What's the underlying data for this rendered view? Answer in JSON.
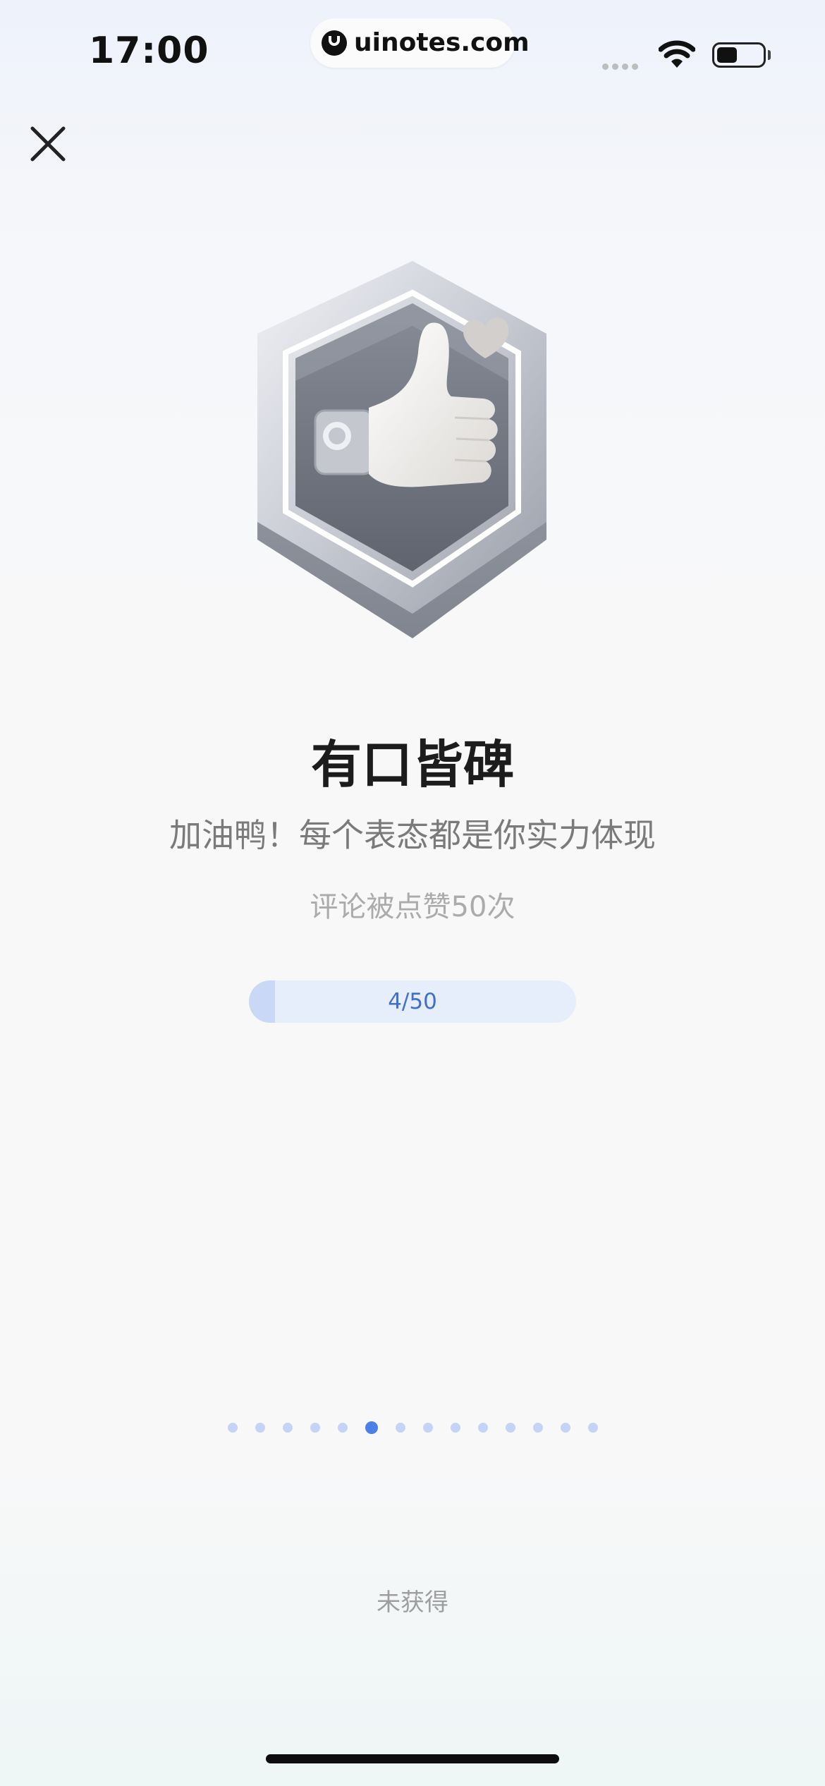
{
  "status_bar": {
    "time": "17:00",
    "url": "uinotes.com",
    "icons": [
      "cellular-signal-icon",
      "wifi-icon",
      "battery-icon"
    ]
  },
  "toolbar": {
    "close_icon": "close-icon"
  },
  "badge": {
    "icon": "thumbs-up-heart-hexagon-badge",
    "title": "有口皆碑",
    "subtitle": "加油鸭！每个表态都是你实力体现",
    "requirement": "评论被点赞50次"
  },
  "progress": {
    "current": 4,
    "total": 50,
    "label": "4/50"
  },
  "pager": {
    "count": 14,
    "active_index": 5
  },
  "status": "未获得",
  "colors": {
    "accent": "#4d7ee6",
    "progress_bg": "#e6edfb",
    "progress_fill": "#c9d8f6",
    "progress_text": "#3f6fd0"
  }
}
